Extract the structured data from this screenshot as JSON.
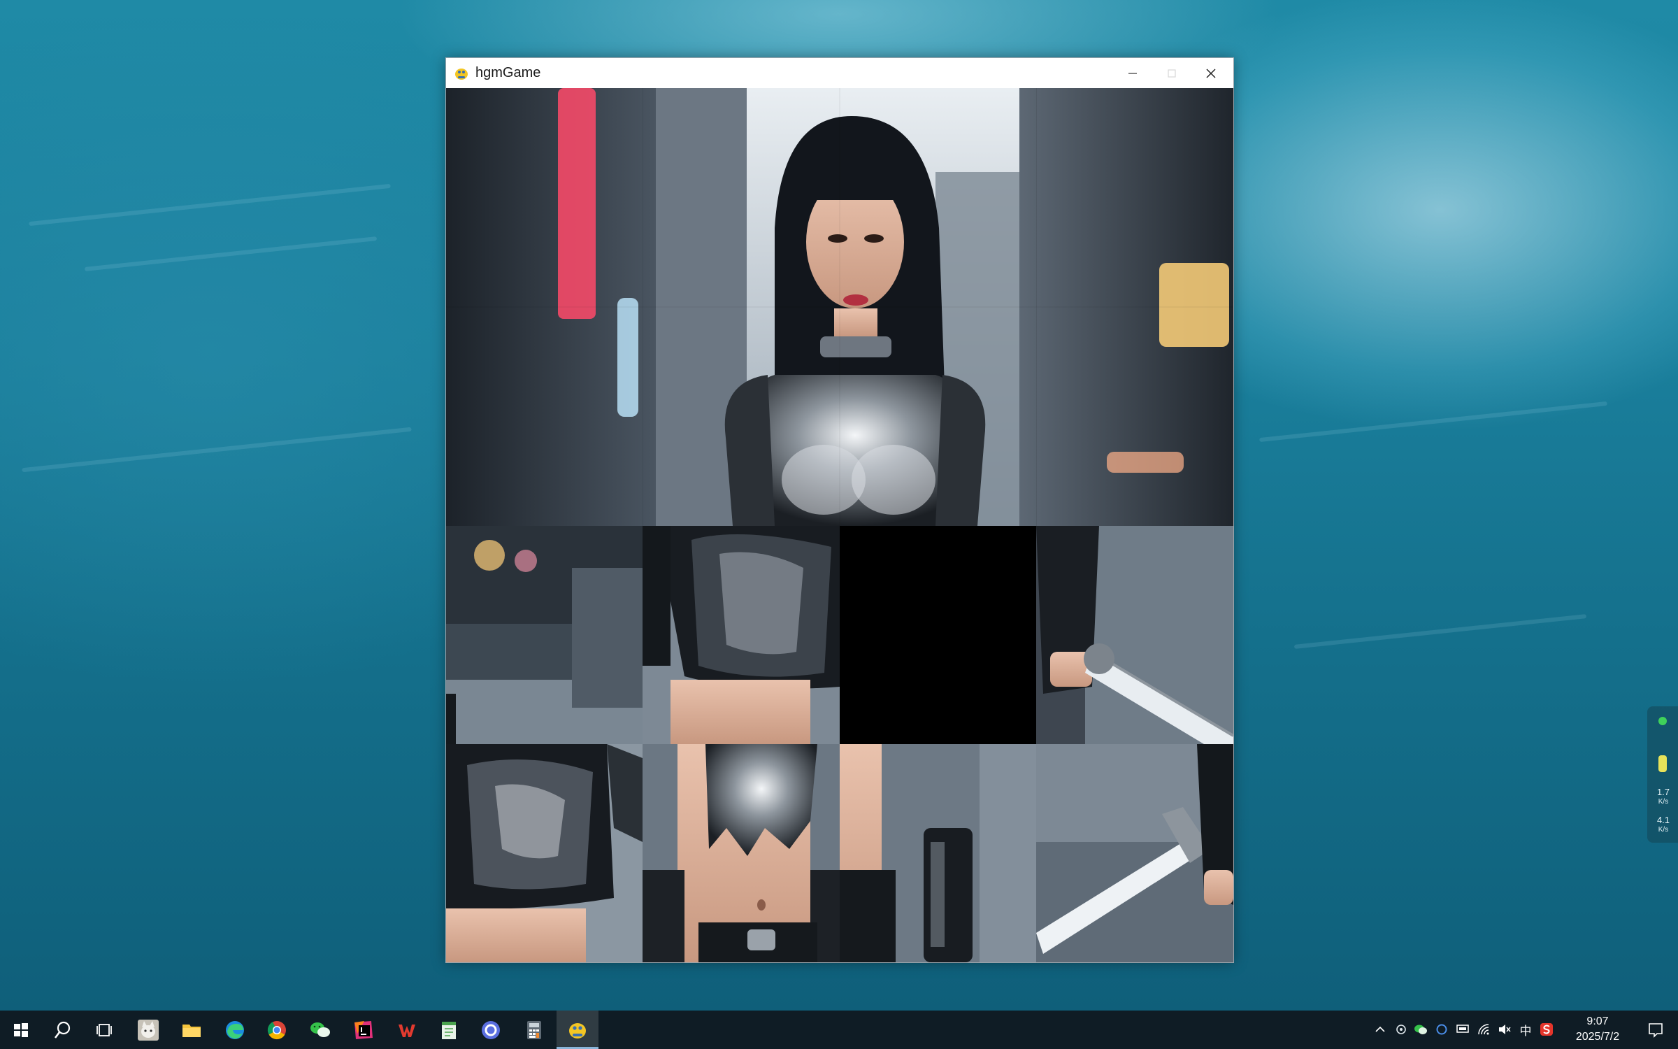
{
  "window": {
    "title": "hgmGame"
  },
  "puzzle": {
    "grid": {
      "cols": 4,
      "rows": 4
    },
    "empty_tile": {
      "row": 2,
      "col": 2
    }
  },
  "net_widget": {
    "upload": "1.7",
    "upload_unit": "K/s",
    "download": "4.1",
    "download_unit": "K/s"
  },
  "taskbar": {
    "apps": [
      {
        "name": "start",
        "icon": "windows-logo-icon"
      },
      {
        "name": "search",
        "icon": "search-icon"
      },
      {
        "name": "task-view",
        "icon": "task-view-icon"
      },
      {
        "name": "avatar-app",
        "icon": "cat-avatar-icon"
      },
      {
        "name": "file-explorer",
        "icon": "folder-icon"
      },
      {
        "name": "edge",
        "icon": "edge-icon"
      },
      {
        "name": "chrome",
        "icon": "chrome-icon"
      },
      {
        "name": "wechat",
        "icon": "wechat-icon"
      },
      {
        "name": "intellij",
        "icon": "intellij-icon"
      },
      {
        "name": "wps",
        "icon": "wps-icon"
      },
      {
        "name": "notepad",
        "icon": "notepad-icon"
      },
      {
        "name": "app-circle",
        "icon": "circle-app-icon"
      },
      {
        "name": "calculator",
        "icon": "calculator-icon"
      },
      {
        "name": "hgmgame",
        "icon": "python-game-icon",
        "active": true
      }
    ],
    "tray": {
      "ime": "中",
      "time": "9:07",
      "date": "2025/7/2"
    }
  },
  "colors": {
    "taskbar_bg": "#0f1c25",
    "window_bg": "#ffffff",
    "empty_tile": "#000000",
    "accent": "#8ab4d8"
  }
}
